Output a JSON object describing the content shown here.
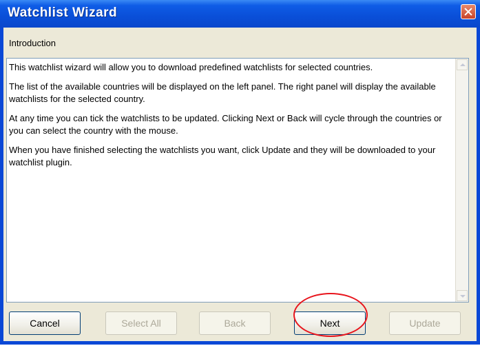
{
  "window": {
    "title": "Watchlist Wizard"
  },
  "section_title": "Introduction",
  "paragraphs": [
    "This watchlist wizard will allow you to download predefined watchlists for selected countries.",
    "The list of the available countries will be displayed on the left panel. The right panel will display the available watchlists for the selected country.",
    "At any time you can tick the watchlists to be updated. Clicking Next or Back will cycle through the countries or you can select the country with the mouse.",
    "When you have finished selecting the watchlists you want, click Update and they will be downloaded to your watchlist plugin."
  ],
  "buttons": {
    "cancel": "Cancel",
    "select_all": "Select All",
    "back": "Back",
    "next": "Next",
    "update": "Update"
  },
  "colors": {
    "title_bar": "#0a4fd8",
    "highlight": "#e8141c",
    "dialog_bg": "#ece9d8"
  },
  "icons": [
    "close-icon",
    "scroll-up-icon",
    "scroll-down-icon"
  ]
}
